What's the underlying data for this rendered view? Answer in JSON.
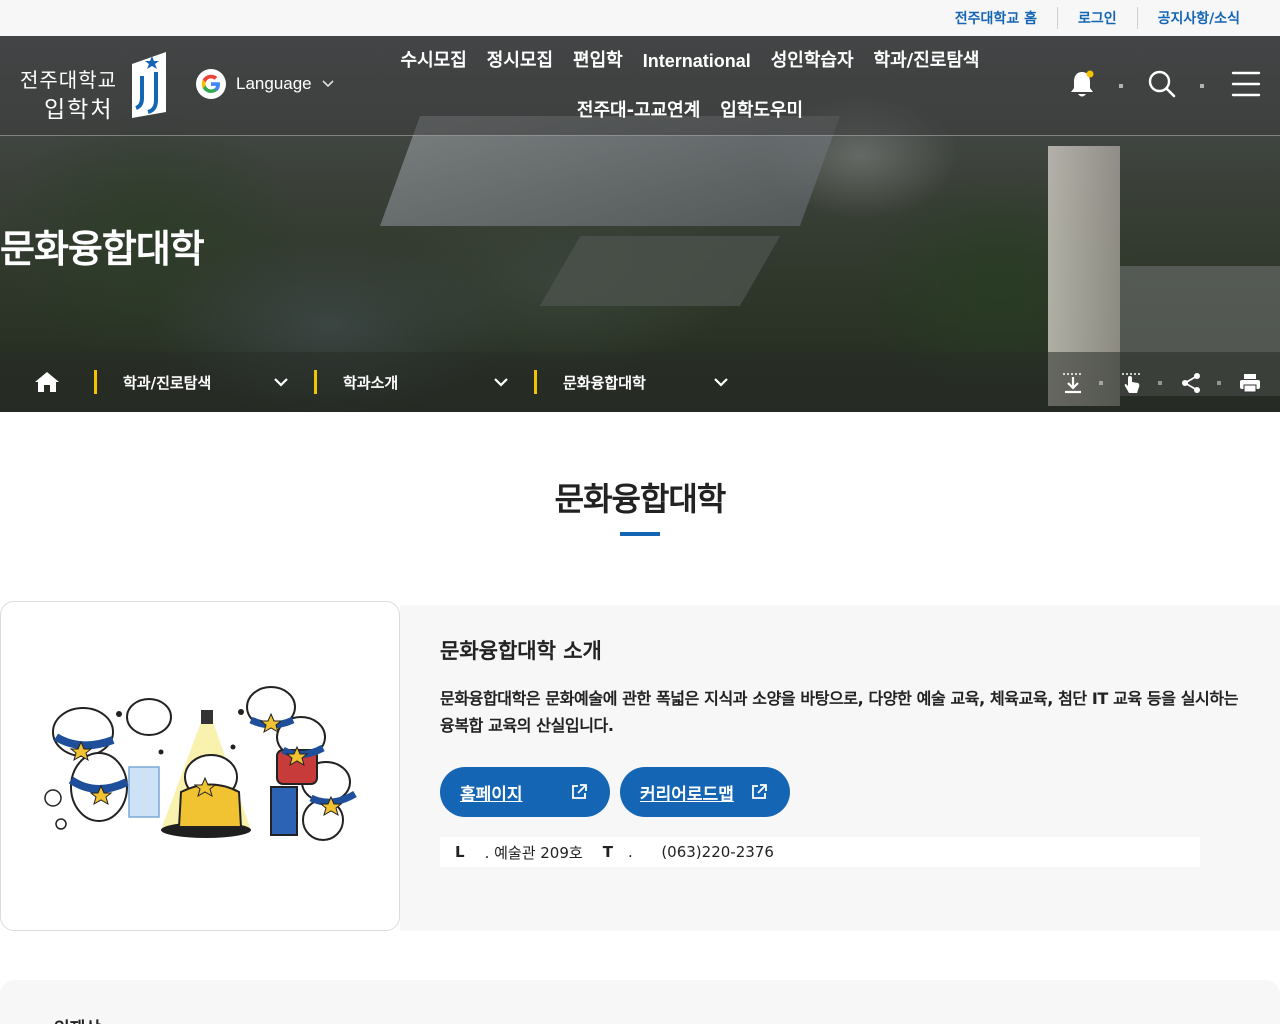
{
  "utility": {
    "links": [
      "전주대학교 홈",
      "로그인",
      "공지사항/소식"
    ]
  },
  "logo": {
    "line1": "전주대학교",
    "line2": "입학처"
  },
  "language": {
    "label": "Language"
  },
  "menu": {
    "items": [
      "수시모집",
      "정시모집",
      "편입학",
      "International",
      "성인학습자",
      "학과/진로탐색",
      "전주대-고교연계",
      "입학도우미"
    ]
  },
  "hero": {
    "title": "문화융합대학"
  },
  "breadcrumb": {
    "items": [
      "학과/진로탐색",
      "학과소개",
      "문화융합대학"
    ]
  },
  "main": {
    "title": "문화융합대학",
    "intro_title": "문화융합대학 소개",
    "intro_desc": "문화융합대학은 문화예술에 관한 폭넓은 지식과 소양을 바탕으로, 다양한 예술 교육, 체육교육, 첨단 IT 교육 등을 실시하는 융복합 교육의 산실입니다.",
    "buttons": [
      "홈페이지",
      "커리어로드맵"
    ],
    "contact": {
      "l_key": "L",
      "l_value": ". 예술관 209호",
      "t_key": "T",
      "t_value": ".      (063)220-2376"
    },
    "next_section": "인재상"
  },
  "colors": {
    "accent": "#1565b5",
    "crumb_bar": "#f5c400"
  }
}
